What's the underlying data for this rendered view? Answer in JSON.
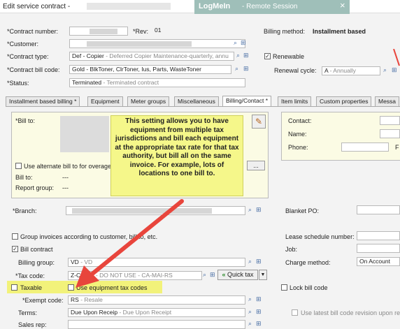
{
  "window": {
    "title": "Edit service contract -",
    "remote_title": "LogMeIn",
    "remote_subtitle": "- Remote Session",
    "close_glyph": "×"
  },
  "header": {
    "contract_number_label": "*Contract number:",
    "rev_label": "*Rev:",
    "rev_value": "01",
    "customer_label": "*Customer:",
    "contract_type_label": "*Contract type:",
    "contract_type_value": "Def - Copier",
    "contract_type_desc": "- Deferred Copier Maintenance-quarterly, annu",
    "bill_code_label": "*Contract bill code:",
    "bill_code_value": "Gold",
    "bill_code_desc": "- BlkToner, ClrToner, Ius, Parts, WasteToner",
    "status_label": "*Status:",
    "status_value": "Terminated",
    "status_desc": "- Terminated contract",
    "billing_method_label": "Billing method:",
    "billing_method_value": "Installment based",
    "renewable_label": "Renewable",
    "renewable_checked": "✓",
    "renewal_cycle_label": "Renewal cycle:",
    "renewal_cycle_value": "A",
    "renewal_cycle_desc": "- Annually"
  },
  "tabs": [
    "Installment based billing *",
    "Equipment",
    "Meter groups",
    "Miscellaneous",
    "Billing/Contact *",
    "Item limits",
    "Custom properties",
    "Messa"
  ],
  "billing": {
    "bill_to_label": "*Bill to:",
    "use_alt_label": "Use alternate bill to for overage",
    "bill_to2_label": "Bill to:",
    "bill_to2_value": "---",
    "report_group_label": "Report group:",
    "report_group_value": "---",
    "ellipsis": "...",
    "branch_label": "*Branch:",
    "group_invoices_label": "Group invoices according to customer, bill to, etc.",
    "bill_contract_label": "Bill contract",
    "bill_contract_checked": "✓",
    "billing_group_label": "Billing group:",
    "billing_group_value": "VD",
    "billing_group_desc": "- VD",
    "tax_code_label": "*Tax code:",
    "tax_code_value": "Z-CA",
    "tax_code_desc": "RS - DO NOT USE - CA-MAI-RS",
    "quick_tax_label": "Quick tax",
    "taxable_label": "Taxable",
    "use_equipment_tax_label": "Use equipment tax codes",
    "exempt_code_label": "*Exempt code:",
    "exempt_code_value": "RS",
    "exempt_code_desc": "- Resale",
    "terms_label": "Terms:",
    "terms_value": "Due Upon Receip",
    "terms_desc": "- Due Upon Receipt",
    "sales_rep_label": "Sales rep:"
  },
  "contact": {
    "contact_label": "Contact:",
    "name_label": "Name:",
    "phone_label": "Phone:",
    "fax_label": "F",
    "blanket_po_label": "Blanket PO:",
    "lease_schedule_label": "Lease schedule number:",
    "job_label": "Job:",
    "charge_method_label": "Charge method:",
    "charge_method_value": "On Account",
    "lock_bill_code_label": "Lock bill code",
    "latest_revision_label": "Use latest bill code revision upon rene"
  },
  "annotation": {
    "text": "This setting allows you to have equipment from multiple tax jurisdictions and bill each equipment at the appropriate tax rate for that tax authority, but bill all on the same invoice. For example, lots of locations to one bill to."
  },
  "colors": {
    "note": "#f5f78a",
    "highlight": "#f2f27a",
    "arrow": "#e8453c",
    "required": "#cc0000",
    "remote_bar": "#9fbfb9"
  }
}
